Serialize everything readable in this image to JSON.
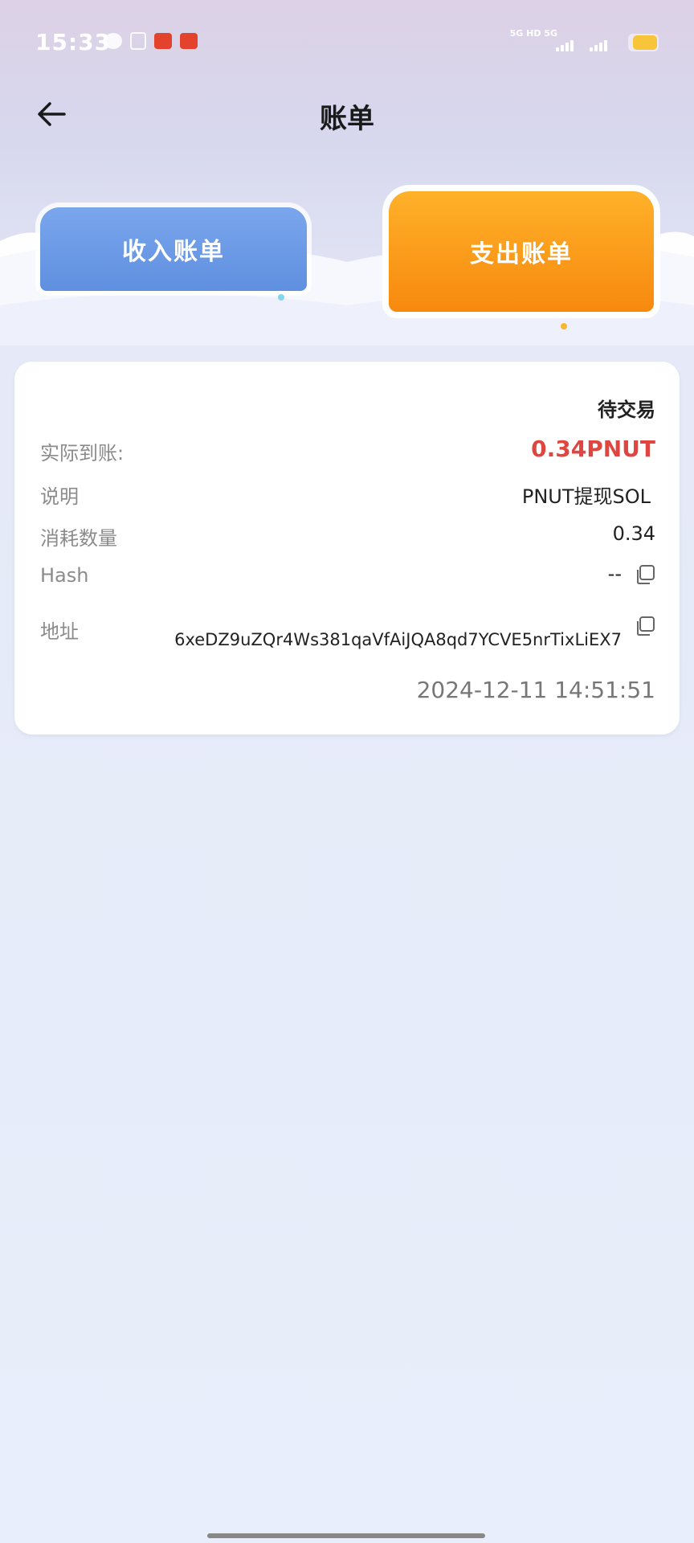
{
  "status_bar": {
    "time": "15:33",
    "network": [
      "5G",
      "HD",
      "5G"
    ],
    "icons": [
      "wechat-icon",
      "doc-icon",
      "app-icon",
      "app-icon"
    ]
  },
  "header": {
    "title": "账单",
    "back_icon": "arrow-left-icon"
  },
  "tabs": {
    "income": "收入账单",
    "expense": "支出账单",
    "active": "expense"
  },
  "record": {
    "status": "待交易",
    "rows": [
      {
        "label": "实际到账:",
        "value": "0.34PNUT"
      },
      {
        "label": "说明",
        "value": "PNUT提现SOL"
      },
      {
        "label": "消耗数量",
        "value": "0.34"
      },
      {
        "label": "Hash",
        "value": "--"
      },
      {
        "label": "地址",
        "value": "6xeDZ9uZQr4Ws381qaVfAiJQA8qd7YCVE5nrTixLiEX7"
      }
    ],
    "timestamp": "2024-12-11 14:51:51"
  },
  "colors": {
    "amount": "#e0463f",
    "income_tab": "#6b98e6",
    "expense_tab": "#f7900f"
  }
}
